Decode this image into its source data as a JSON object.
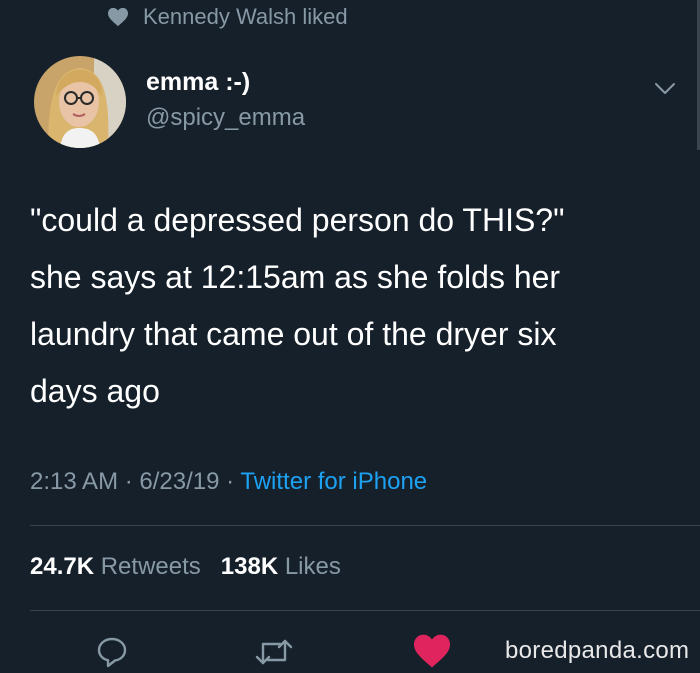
{
  "social_context": {
    "icon": "heart-icon",
    "text": "Kennedy Walsh liked"
  },
  "author": {
    "display_name": "emma :-)",
    "handle": "@spicy_emma",
    "avatar": "avatar-photo"
  },
  "tweet": {
    "text": "\"could a depressed person do THIS?\"\nshe says at 12:15am as she folds her\nlaundry that came out of the dryer six\ndays ago"
  },
  "meta": {
    "time": "2:13 AM",
    "separator": "·",
    "date": "6/23/19",
    "source": "Twitter for iPhone"
  },
  "stats": {
    "retweets_count": "24.7K",
    "retweets_label": "Retweets",
    "likes_count": "138K",
    "likes_label": "Likes"
  },
  "actions": {
    "reply_icon": "reply-icon",
    "retweet_icon": "retweet-icon",
    "like_icon": "heart-icon",
    "like_color": "#e0245e"
  },
  "watermark": {
    "text": "boredpanda.com"
  },
  "colors": {
    "background": "#15202b",
    "text": "#ffffff",
    "secondary": "#8899a6",
    "link": "#1da1f2",
    "divider": "#38444d"
  }
}
